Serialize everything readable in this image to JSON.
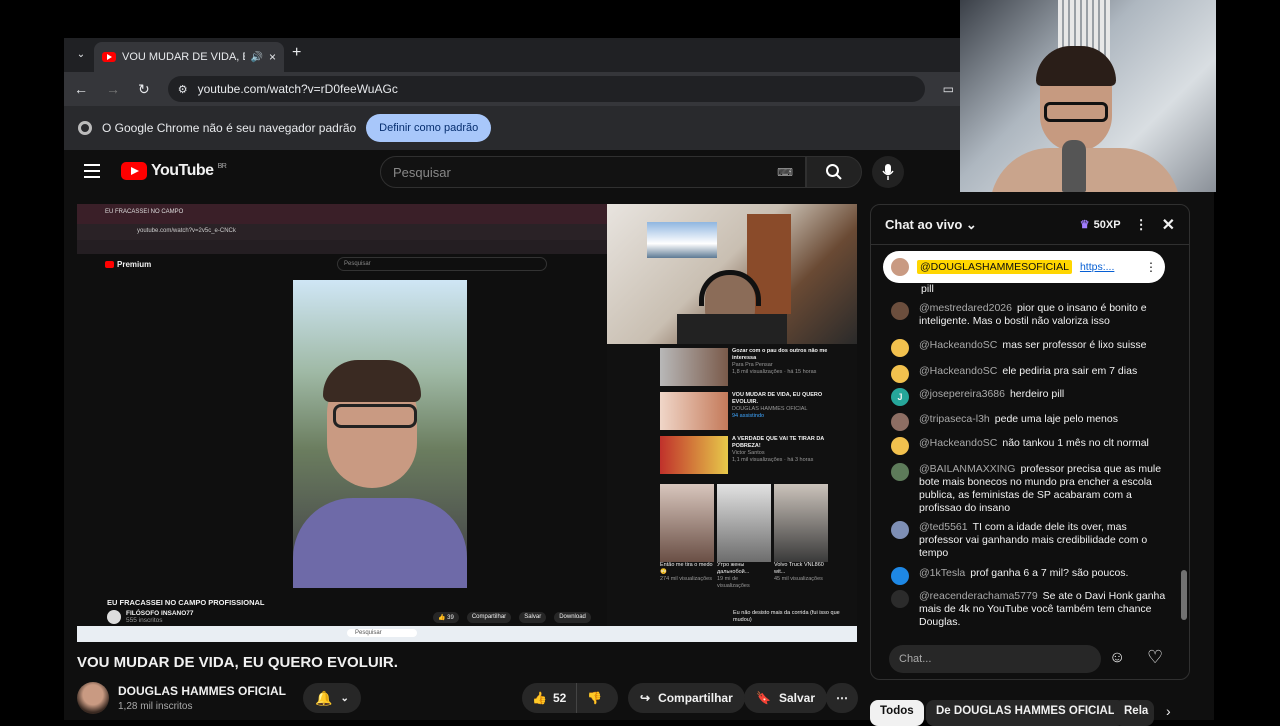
{
  "browser": {
    "tab_title": "VOU MUDAR DE VIDA, EU QU",
    "url": "youtube.com/watch?v=rD0feeWuAGc",
    "infobar_text": "O Google Chrome não é seu navegador padrão",
    "infobar_button": "Definir como padrão"
  },
  "youtube": {
    "logo_text": "YouTube",
    "region": "BR",
    "search_placeholder": "Pesquisar"
  },
  "video": {
    "inner_tab": "EU FRACASSEI NO CAMPO",
    "inner_url": "youtube.com/watch?v=2v5c_e-CNCk",
    "inner_logo": "Premium",
    "inner_search": "Pesquisar",
    "inner_title": "EU FRACASSEI NO CAMPO PROFISSIONAL",
    "inner_channel": "FILÓSOFO INSANO77",
    "inner_subs": "555 inscritos",
    "inner_likes": "39",
    "inner_share": "Compartilhar",
    "inner_save": "Salvar",
    "inner_download": "Download",
    "recs": [
      {
        "title": "Gozar com o pau dos outros não me interessa",
        "channel": "Para Pra Pensar",
        "meta": "1,8 mil visualizações · há 15 horas"
      },
      {
        "title": "VOU MUDAR DE VIDA, EU QUERO EVOLUIR.",
        "channel": "DOUGLAS HAMMES OFICIAL",
        "meta": "94 assistindo"
      },
      {
        "title": "A VERDADE QUE VAI TE TIRAR DA POBREZA!",
        "channel": "Victor Santos",
        "meta": "1,1 mil visualizações · há 3 horas"
      }
    ],
    "shorts": [
      {
        "title": "Então me tira o medo 😳",
        "meta": "274 mil visualizações"
      },
      {
        "title": "Утро жены дальнобой...",
        "meta": "19 mi de visualizações"
      },
      {
        "title": "Volvo Truck VNL860 wit...",
        "meta": "45 mil visualizações"
      }
    ],
    "last_rec": "Eu não desisto mais da corrida (fui isso que mudou)",
    "taskbar_search": "Pesquisar"
  },
  "watch": {
    "title": "VOU MUDAR DE VIDA, EU QUERO EVOLUIR.",
    "channel": "DOUGLAS HAMMES OFICIAL",
    "subs": "1,28 mil inscritos",
    "likes": "52",
    "share": "Compartilhar",
    "save": "Salvar"
  },
  "chat": {
    "header": "Chat ao vivo",
    "xp": "50XP",
    "pinned_user": "@DOUGLASHAMMESOFICIAL",
    "pinned_link": "https:...",
    "partial_line": "pill",
    "messages": [
      {
        "author": "@mestredared2026",
        "text": "pior que o insano é bonito e inteligente. Mas o bostil não valoriza isso",
        "color": "#6b4e3d"
      },
      {
        "author": "@HackeandoSC",
        "text": "mas ser professor é lixo suisse",
        "color": "#f2c14e"
      },
      {
        "author": "@HackeandoSC",
        "text": "ele pediria pra sair em 7 dias",
        "color": "#f2c14e"
      },
      {
        "author": "@josepereira3686",
        "text": "herdeiro pill",
        "color": "#26a69a",
        "initial": "J"
      },
      {
        "author": "@tripaseca-l3h",
        "text": "pede uma laje pelo menos",
        "color": "#8d6e63"
      },
      {
        "author": "@HackeandoSC",
        "text": "não tankou 1 mês no clt normal",
        "color": "#f2c14e"
      },
      {
        "author": "@BAILANMAXXING",
        "text": "professor precisa que as mule bote mais bonecos no mundo pra encher a escola publica, as feministas de SP acabaram com a profissao do insano",
        "color": "#5d7b5a"
      },
      {
        "author": "@ted5561",
        "text": "TI com a idade dele its over, mas professor vai ganhando mais credibilidade com o tempo",
        "color": "#7e8fb5"
      },
      {
        "author": "@1kTesla",
        "text": "prof ganha 6 a 7 mil? são poucos.",
        "color": "#1e88e5"
      },
      {
        "author": "@reacenderachama5779",
        "text": "Se ate o Davi Honk ganha mais de 4k no YouTube você também tem chance Douglas.",
        "color": "#2b2b2b"
      }
    ],
    "input_placeholder": "Chat..."
  },
  "chips": [
    "Todos",
    "De DOUGLAS HAMMES OFICIAL",
    "Rela"
  ]
}
